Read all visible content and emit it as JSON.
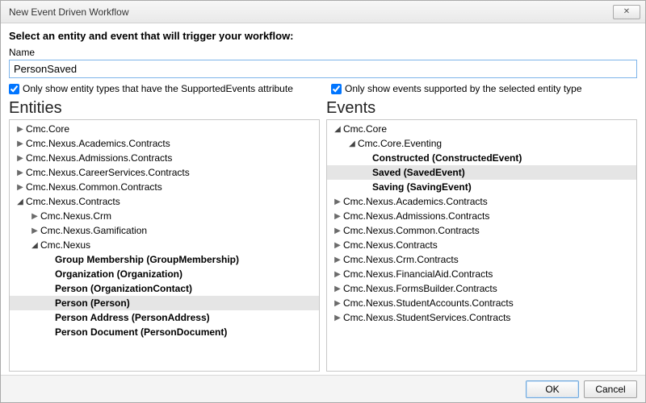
{
  "window": {
    "title": "New Event Driven Workflow"
  },
  "prompt": "Select an entity and event that will trigger your workflow:",
  "name": {
    "label": "Name",
    "value": "PersonSaved"
  },
  "checks": {
    "entity_filter": "Only show entity types that have the SupportedEvents attribute",
    "event_filter": "Only show events supported by the selected entity type"
  },
  "headings": {
    "entities": "Entities",
    "events": "Events"
  },
  "buttons": {
    "ok": "OK",
    "cancel": "Cancel"
  },
  "glyphs": {
    "collapsed": "▶",
    "expanded": "◢"
  },
  "entities_tree": [
    {
      "depth": 0,
      "exp": "collapsed",
      "label": "Cmc.Core"
    },
    {
      "depth": 0,
      "exp": "collapsed",
      "label": "Cmc.Nexus.Academics.Contracts"
    },
    {
      "depth": 0,
      "exp": "collapsed",
      "label": "Cmc.Nexus.Admissions.Contracts"
    },
    {
      "depth": 0,
      "exp": "collapsed",
      "label": "Cmc.Nexus.CareerServices.Contracts"
    },
    {
      "depth": 0,
      "exp": "collapsed",
      "label": "Cmc.Nexus.Common.Contracts"
    },
    {
      "depth": 0,
      "exp": "expanded",
      "label": "Cmc.Nexus.Contracts"
    },
    {
      "depth": 1,
      "exp": "collapsed",
      "label": "Cmc.Nexus.Crm"
    },
    {
      "depth": 1,
      "exp": "collapsed",
      "label": "Cmc.Nexus.Gamification"
    },
    {
      "depth": 1,
      "exp": "expanded",
      "label": "Cmc.Nexus"
    },
    {
      "depth": 2,
      "exp": "none",
      "bold": true,
      "label": "Group Membership (GroupMembership)"
    },
    {
      "depth": 2,
      "exp": "none",
      "bold": true,
      "label": "Organization (Organization)"
    },
    {
      "depth": 2,
      "exp": "none",
      "bold": true,
      "label": "Person (OrganizationContact)"
    },
    {
      "depth": 2,
      "exp": "none",
      "bold": true,
      "selected": true,
      "label": "Person (Person)"
    },
    {
      "depth": 2,
      "exp": "none",
      "bold": true,
      "label": "Person Address (PersonAddress)"
    },
    {
      "depth": 2,
      "exp": "none",
      "bold": true,
      "label": "Person Document (PersonDocument)"
    }
  ],
  "events_tree": [
    {
      "depth": 0,
      "exp": "expanded",
      "label": "Cmc.Core"
    },
    {
      "depth": 1,
      "exp": "expanded",
      "label": "Cmc.Core.Eventing"
    },
    {
      "depth": 2,
      "exp": "none",
      "bold": true,
      "label": "Constructed (ConstructedEvent)"
    },
    {
      "depth": 2,
      "exp": "none",
      "bold": true,
      "selected": true,
      "label": "Saved (SavedEvent)"
    },
    {
      "depth": 2,
      "exp": "none",
      "bold": true,
      "label": "Saving (SavingEvent)"
    },
    {
      "depth": 0,
      "exp": "collapsed",
      "label": "Cmc.Nexus.Academics.Contracts"
    },
    {
      "depth": 0,
      "exp": "collapsed",
      "label": "Cmc.Nexus.Admissions.Contracts"
    },
    {
      "depth": 0,
      "exp": "collapsed",
      "label": "Cmc.Nexus.Common.Contracts"
    },
    {
      "depth": 0,
      "exp": "collapsed",
      "label": "Cmc.Nexus.Contracts"
    },
    {
      "depth": 0,
      "exp": "collapsed",
      "label": "Cmc.Nexus.Crm.Contracts"
    },
    {
      "depth": 0,
      "exp": "collapsed",
      "label": "Cmc.Nexus.FinancialAid.Contracts"
    },
    {
      "depth": 0,
      "exp": "collapsed",
      "label": "Cmc.Nexus.FormsBuilder.Contracts"
    },
    {
      "depth": 0,
      "exp": "collapsed",
      "label": "Cmc.Nexus.StudentAccounts.Contracts"
    },
    {
      "depth": 0,
      "exp": "collapsed",
      "label": "Cmc.Nexus.StudentServices.Contracts"
    }
  ]
}
